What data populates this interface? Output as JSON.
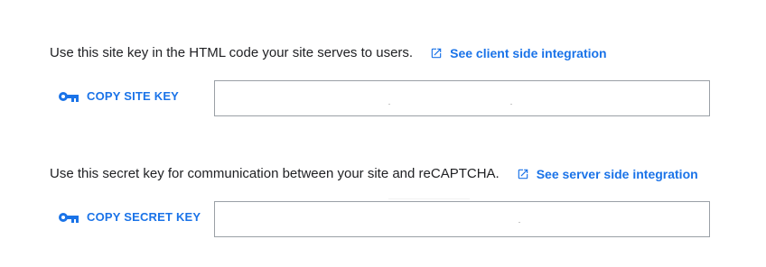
{
  "site_key": {
    "description": "Use this site key in the HTML code your site serves to users.",
    "integration_link": "See client side integration",
    "copy_label": "COPY SITE KEY",
    "value": ""
  },
  "secret_key": {
    "description": "Use this secret key for communication between your site and reCAPTCHA.",
    "integration_link": "See server side integration",
    "copy_label": "COPY SECRET KEY",
    "value": ""
  },
  "colors": {
    "accent": "#1a73e8",
    "text": "#202124",
    "field_border": "#9aa0a6"
  },
  "icons": {
    "link": "open-in-new-icon",
    "copy": "key-icon"
  }
}
